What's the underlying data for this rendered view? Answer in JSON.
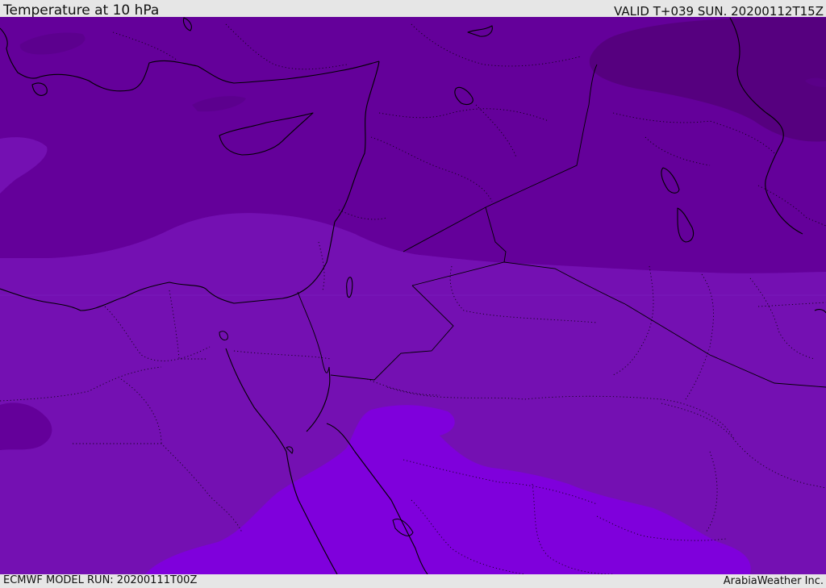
{
  "header": {
    "title": "Temperature at 10 hPa",
    "valid_time": "VALID T+039 SUN. 20200112T15Z"
  },
  "footer": {
    "model_run": "ECMWF MODEL RUN: 20200111T00Z",
    "credit": "ArabiaWeather Inc."
  },
  "colors": {
    "frame": "#e6e6e6",
    "field_darkest": "#56007f",
    "field_dark": "#64009a",
    "field_mid": "#7410b2",
    "field_light": "#7f00dc",
    "coastline": "#000000"
  }
}
